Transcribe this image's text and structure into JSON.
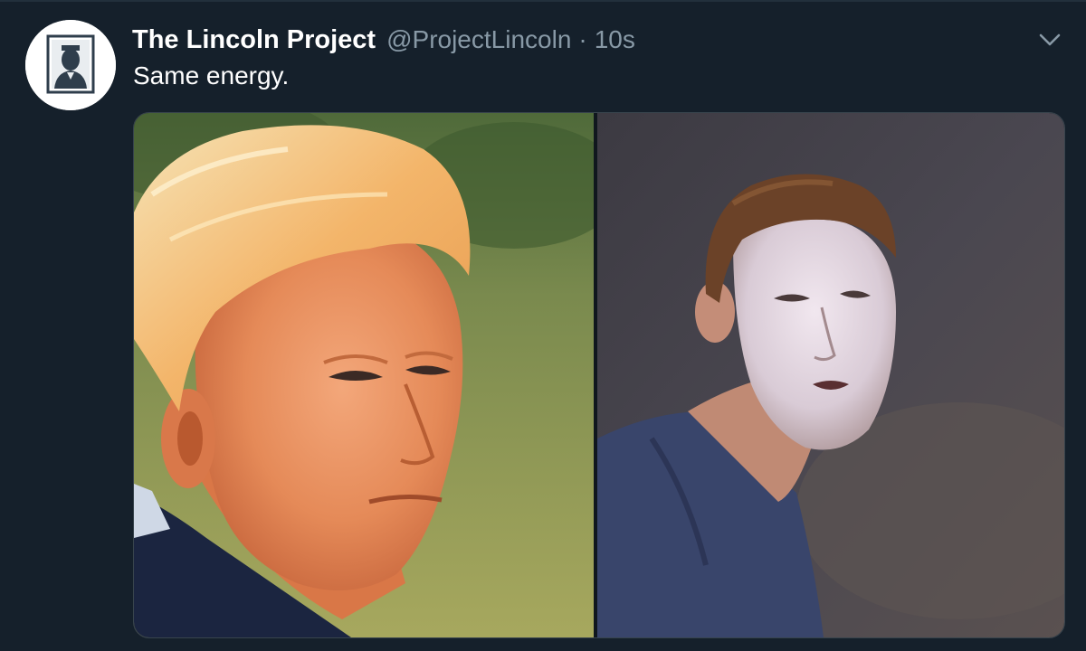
{
  "tweet": {
    "author": {
      "display_name": "The Lincoln Project",
      "handle": "@ProjectLincoln",
      "avatar_icon": "lincoln-portrait-avatar"
    },
    "separator": "·",
    "timestamp": "10s",
    "text": "Same energy.",
    "menu_icon": "chevron-down-icon",
    "media": {
      "photos": [
        {
          "subject": "orange-tanned-man-portrait"
        },
        {
          "subject": "pale-faced-man-portrait"
        }
      ]
    }
  },
  "colors": {
    "background": "#15202b",
    "primary_text": "#ffffff",
    "secondary_text": "#8899a6",
    "border": "#38444d"
  }
}
